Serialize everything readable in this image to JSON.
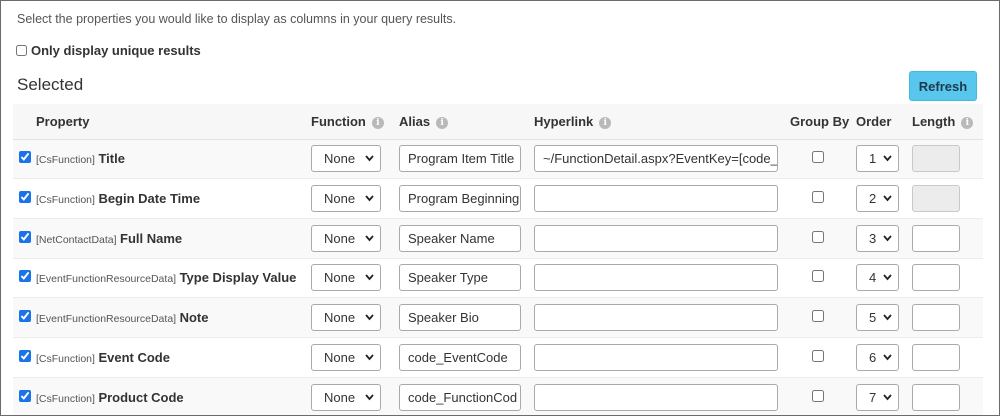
{
  "intro": "Select the properties you would like to display as columns in your query results.",
  "unique_label": "Only display unique results",
  "section_title": "Selected",
  "refresh_label": "Refresh",
  "columns": {
    "property": "Property",
    "function": "Function",
    "alias": "Alias",
    "hyperlink": "Hyperlink",
    "group_by": "Group By",
    "order": "Order",
    "length": "Length"
  },
  "info_glyph": "i",
  "rows": [
    {
      "checked": true,
      "source": "[CsFunction]",
      "name": "Title",
      "function": "None",
      "alias": "Program Item Title",
      "hyperlink": "~/FunctionDetail.aspx?EventKey=[code_E",
      "group_by": false,
      "order": "1",
      "length": "",
      "length_disabled": true
    },
    {
      "checked": true,
      "source": "[CsFunction]",
      "name": "Begin Date Time",
      "function": "None",
      "alias": "Program Beginning",
      "hyperlink": "",
      "group_by": false,
      "order": "2",
      "length": "",
      "length_disabled": true
    },
    {
      "checked": true,
      "source": "[NetContactData]",
      "name": "Full Name",
      "function": "None",
      "alias": "Speaker Name",
      "hyperlink": "",
      "group_by": false,
      "order": "3",
      "length": "",
      "length_disabled": false
    },
    {
      "checked": true,
      "source": "[EventFunctionResourceData]",
      "name": "Type Display Value",
      "function": "None",
      "alias": "Speaker Type",
      "hyperlink": "",
      "group_by": false,
      "order": "4",
      "length": "",
      "length_disabled": false
    },
    {
      "checked": true,
      "source": "[EventFunctionResourceData]",
      "name": "Note",
      "function": "None",
      "alias": "Speaker Bio",
      "hyperlink": "",
      "group_by": false,
      "order": "5",
      "length": "",
      "length_disabled": false
    },
    {
      "checked": true,
      "source": "[CsFunction]",
      "name": "Event Code",
      "function": "None",
      "alias": "code_EventCode",
      "hyperlink": "",
      "group_by": false,
      "order": "6",
      "length": "",
      "length_disabled": false
    },
    {
      "checked": true,
      "source": "[CsFunction]",
      "name": "Product Code",
      "function": "None",
      "alias": "code_FunctionCod",
      "hyperlink": "",
      "group_by": false,
      "order": "7",
      "length": "",
      "length_disabled": false
    }
  ],
  "colors": {
    "refresh": "#59c6ee",
    "check": "#1a73e8"
  }
}
